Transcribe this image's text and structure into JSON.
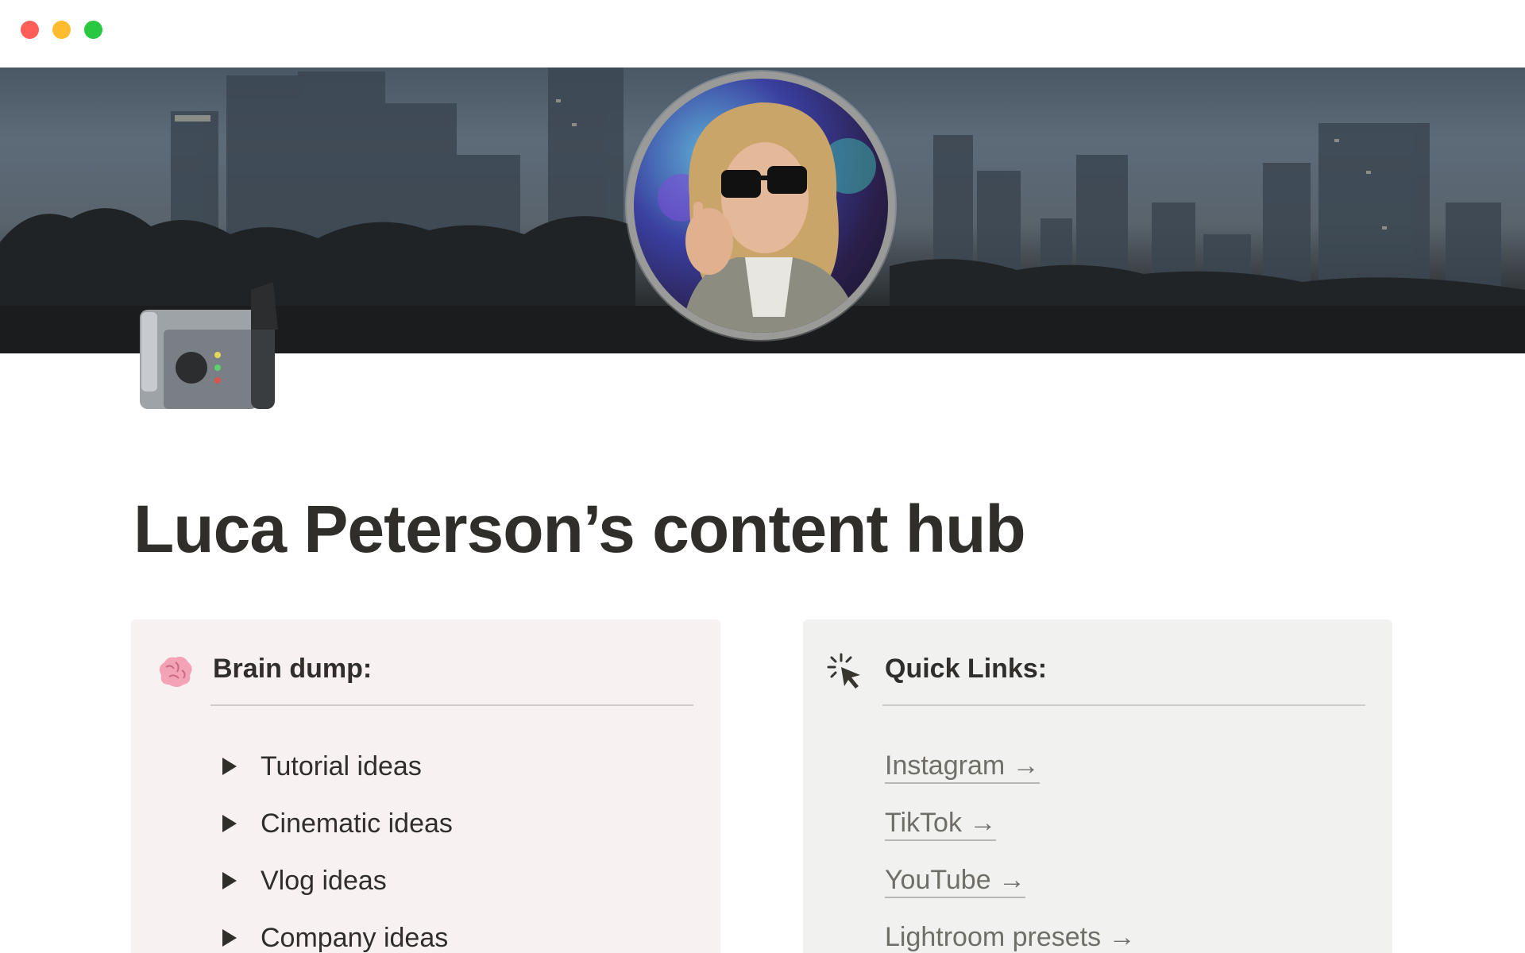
{
  "window": {
    "controls": [
      "close",
      "minimize",
      "maximize"
    ]
  },
  "cover": {
    "description_icon": "city-skyline-cover"
  },
  "page": {
    "icon": "video-camera-icon",
    "title": "Luca Peterson’s content hub"
  },
  "brain_dump": {
    "icon": "brain-icon",
    "heading": "Brain dump:",
    "items": [
      {
        "label": "Tutorial ideas"
      },
      {
        "label": "Cinematic ideas"
      },
      {
        "label": "Vlog ideas"
      },
      {
        "label": "Company ideas"
      }
    ]
  },
  "quick_links": {
    "icon": "cursor-click-icon",
    "heading": "Quick Links:",
    "items": [
      {
        "label": "Instagram →"
      },
      {
        "label": "TikTok →"
      },
      {
        "label": "YouTube →"
      },
      {
        "label": "Lightroom presets →"
      }
    ]
  },
  "colors": {
    "brain_bg": "#f8f1f2",
    "links_bg": "#f1f1ef",
    "text": "#2f2e2a",
    "link_text": "#6f6e69"
  }
}
